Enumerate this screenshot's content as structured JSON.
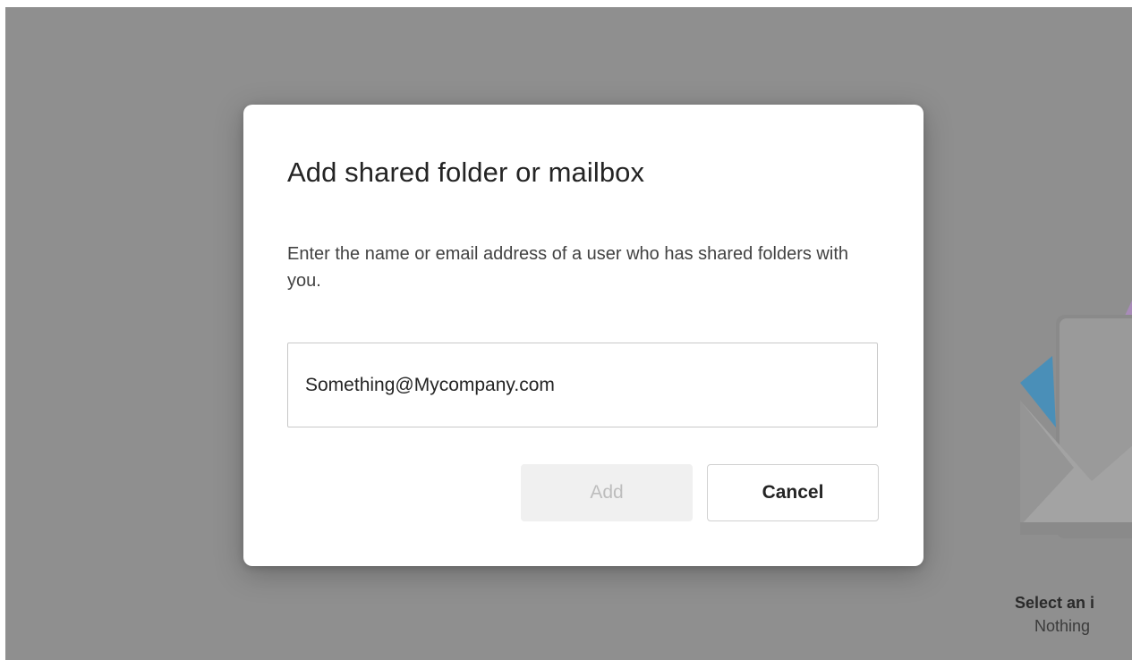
{
  "dialog": {
    "title": "Add shared folder or mailbox",
    "description": "Enter the name or email address of a user who has shared folders with you.",
    "input": {
      "value": "Something@Mycompany.com",
      "placeholder": ""
    },
    "add_label": "Add",
    "cancel_label": "Cancel"
  },
  "background": {
    "empty_state_title": "Select an i",
    "empty_state_subtitle": "Nothing",
    "illustration_icon": "envelope-icon"
  },
  "colors": {
    "overlay": "#8f8f8f",
    "dialog_bg": "#ffffff",
    "text_primary": "#242424",
    "disabled_button_bg": "#f0f0f0",
    "disabled_button_text": "#bdbdbd"
  }
}
